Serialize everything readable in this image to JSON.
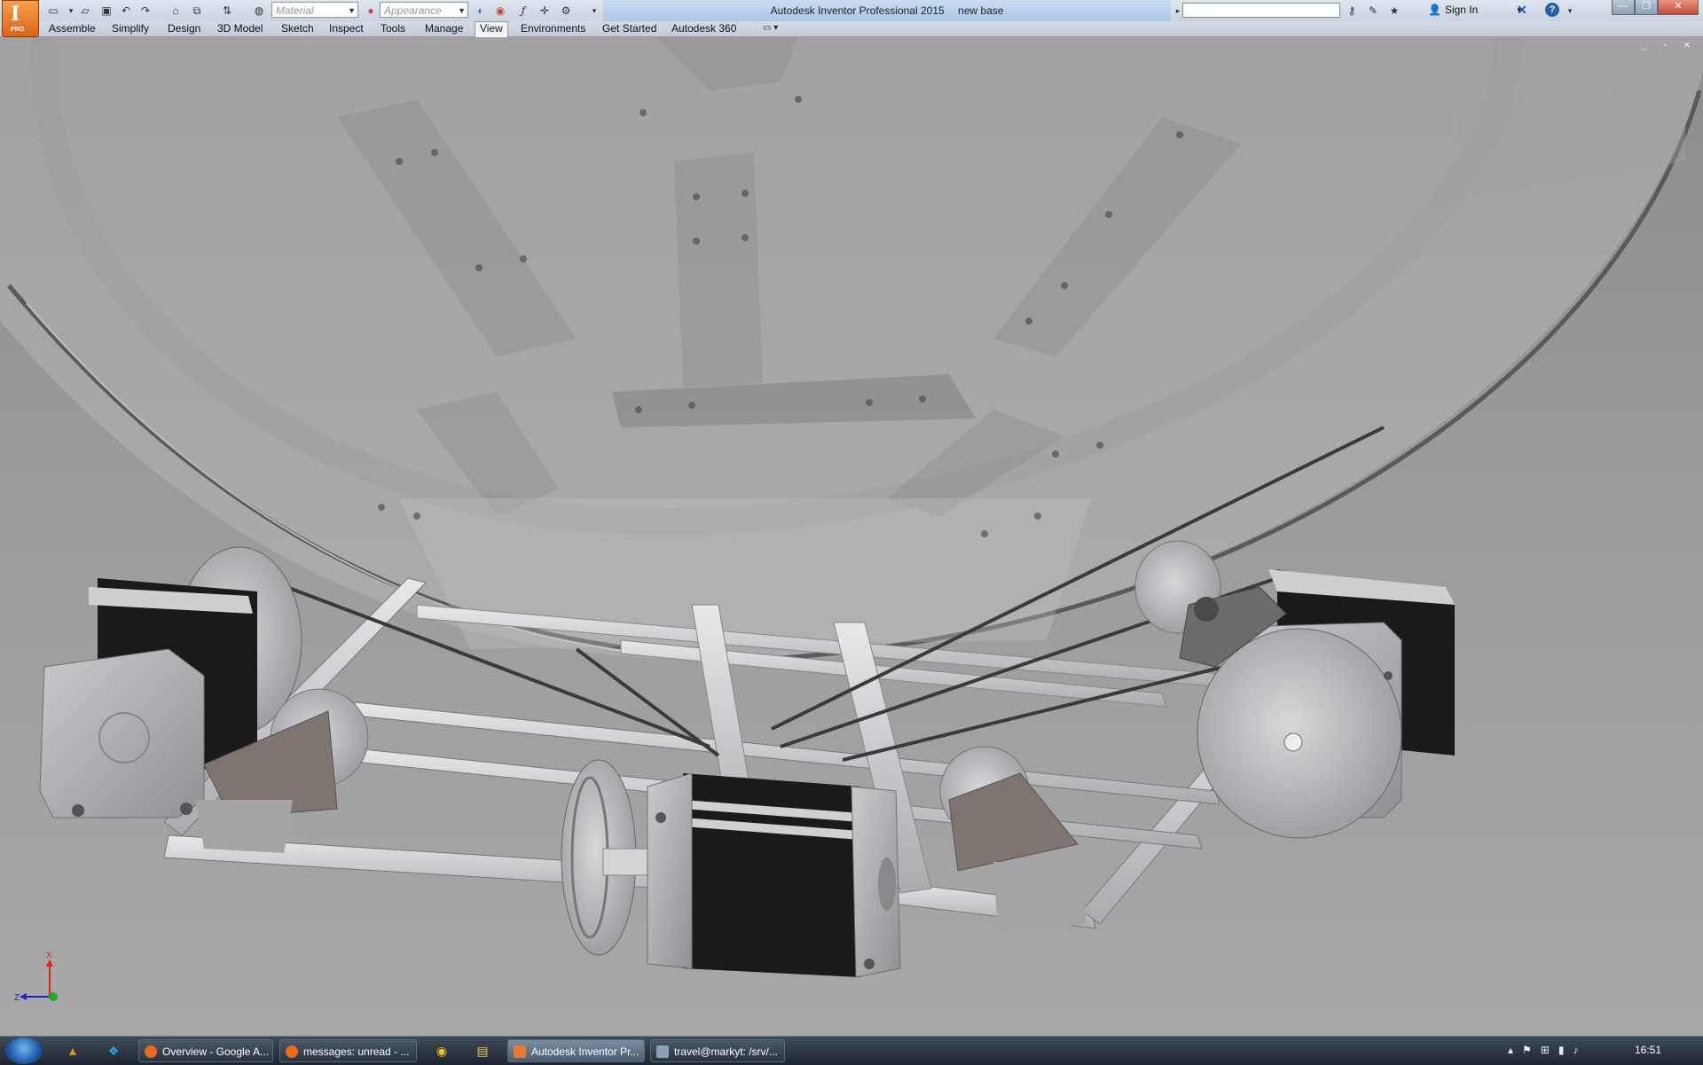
{
  "app": {
    "badge_letter": "I",
    "badge_edition": "PRO",
    "title": "Autodesk Inventor Professional 2015",
    "document": "new base"
  },
  "quick_access": {
    "material_placeholder": "Material",
    "appearance_placeholder": "Appearance",
    "search_value": "",
    "signin_label": "Sign In"
  },
  "ribbon_tabs": [
    {
      "label": "Assemble"
    },
    {
      "label": "Simplify"
    },
    {
      "label": "Design"
    },
    {
      "label": "3D Model"
    },
    {
      "label": "Sketch"
    },
    {
      "label": "Inspect"
    },
    {
      "label": "Tools"
    },
    {
      "label": "Manage"
    },
    {
      "label": "View",
      "active": true
    },
    {
      "label": "Environments"
    },
    {
      "label": "Get Started"
    },
    {
      "label": "Autodesk 360"
    }
  ],
  "triad": {
    "x_label": "X",
    "z_label": "Z"
  },
  "taskbar": {
    "buttons": [
      {
        "label": "Overview - Google A...",
        "icon": "firefox-icon"
      },
      {
        "label": "messages: unread - ...",
        "icon": "firefox-icon"
      },
      {
        "label": "Autodesk Inventor Pr...",
        "icon": "inventor-icon",
        "active": true
      },
      {
        "label": "travel@markyt: /srv/...",
        "icon": "putty-icon"
      }
    ],
    "clock": "16:51"
  },
  "colors": {
    "accent": "#e87a2a",
    "title_bar": "#c8dcf0",
    "motor_body": "#1a1a1a",
    "aluminum": "#c4c6c8"
  }
}
